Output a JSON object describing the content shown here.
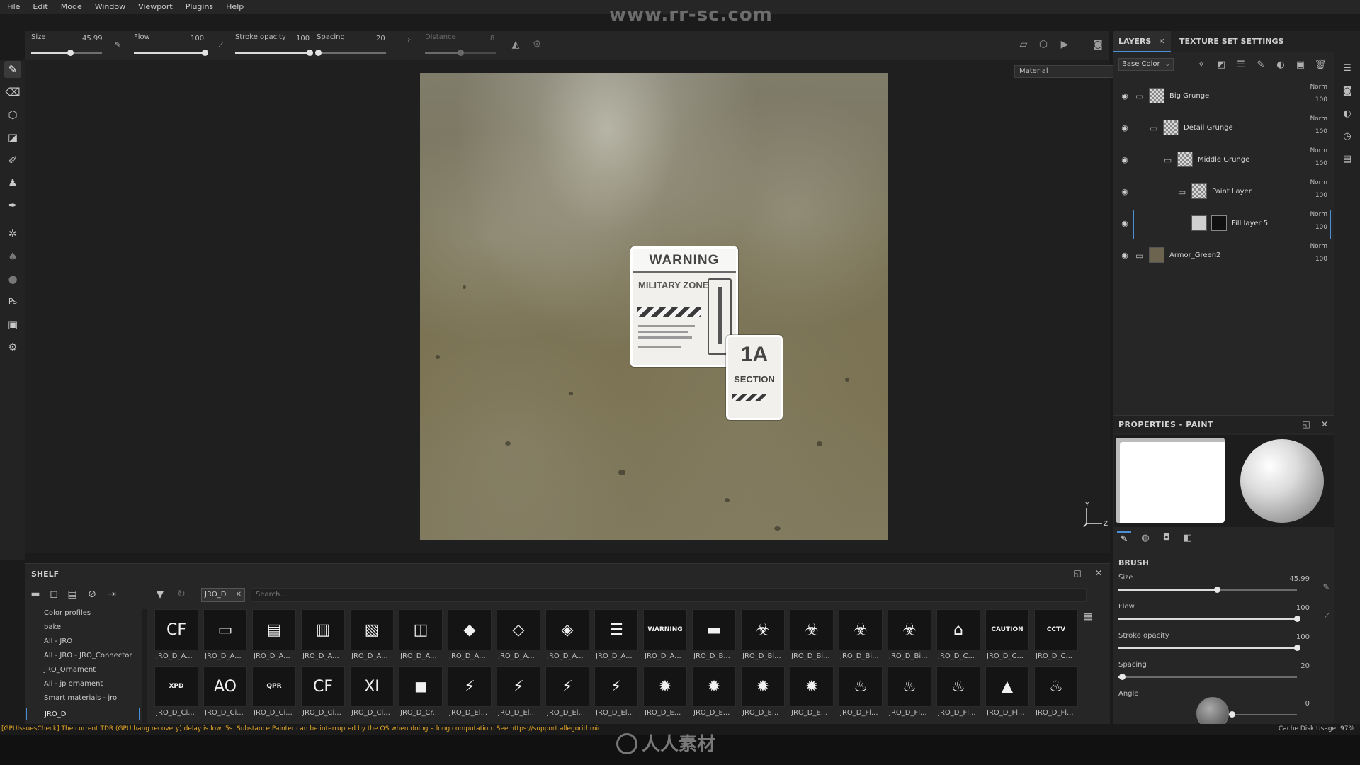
{
  "watermark": "www.rr-sc.com",
  "menu": [
    "File",
    "Edit",
    "Mode",
    "Window",
    "Viewport",
    "Plugins",
    "Help"
  ],
  "tool_options": {
    "size": {
      "label": "Size",
      "value": "45.99",
      "fraction": 0.55
    },
    "flow": {
      "label": "Flow",
      "value": "100",
      "fraction": 1.0
    },
    "stroke_opacity": {
      "label": "Stroke opacity",
      "value": "100",
      "fraction": 1.0
    },
    "spacing": {
      "label": "Spacing",
      "value": "20",
      "fraction": 0.02
    },
    "distance": {
      "label": "Distance",
      "value": "8",
      "fraction": 0.5
    }
  },
  "viewport": {
    "material_select": "Material",
    "decal_warning": {
      "title": "WARNING",
      "subtitle": "MILITARY ZONE"
    },
    "decal_section": {
      "number": "1A",
      "word": "SECTION"
    },
    "gizmo": {
      "y": "Y",
      "z": "Z"
    }
  },
  "right_panel": {
    "tabs": {
      "layers": "LAYERS",
      "texture_set_settings": "TEXTURE SET SETTINGS"
    },
    "channel_select": "Base Color",
    "layers": [
      {
        "name": "Big Grunge",
        "blend": "Norm",
        "opacity": "100",
        "indent": 0,
        "thumb": "checker",
        "folder": true
      },
      {
        "name": "Detail Grunge",
        "blend": "Norm",
        "opacity": "100",
        "indent": 1,
        "thumb": "checker",
        "folder": true
      },
      {
        "name": "Middle Grunge",
        "blend": "Norm",
        "opacity": "100",
        "indent": 2,
        "thumb": "checker",
        "folder": true
      },
      {
        "name": "Paint Layer",
        "blend": "Norm",
        "opacity": "100",
        "indent": 3,
        "thumb": "checker",
        "folder": true
      },
      {
        "name": "Fill layer 5",
        "blend": "Norm",
        "opacity": "100",
        "indent": 4,
        "thumb": "plain",
        "folder": false,
        "selected": true
      },
      {
        "name": "Armor_Green2",
        "blend": "Norm",
        "opacity": "100",
        "indent": 0,
        "thumb": "armor",
        "folder": true
      }
    ],
    "properties": {
      "title": "PROPERTIES - PAINT",
      "brush_title": "BRUSH",
      "sliders": [
        {
          "label": "Size",
          "value": "45.99",
          "fraction": 0.55
        },
        {
          "label": "Flow",
          "value": "100",
          "fraction": 1.0
        },
        {
          "label": "Stroke opacity",
          "value": "100",
          "fraction": 1.0
        },
        {
          "label": "Spacing",
          "value": "20",
          "fraction": 0.02
        },
        {
          "label": "Angle",
          "value": "0",
          "fraction": 0.0
        }
      ]
    }
  },
  "shelf": {
    "title": "SHELF",
    "filter_chip": "JRO_D",
    "search_placeholder": "Search...",
    "categories": [
      "Color profiles",
      "bake",
      "All - JRO",
      "All - JRO - JRO_Connector",
      "JRO_Ornament",
      "All - jp ornament",
      "Smart materials - jro",
      "JRO_D"
    ],
    "selected_category": "JRO_D",
    "row1": [
      {
        "name": "JRO_D_A...",
        "icon": "CF"
      },
      {
        "name": "JRO_D_A...",
        "icon": "▭"
      },
      {
        "name": "JRO_D_A...",
        "icon": "▤"
      },
      {
        "name": "JRO_D_A...",
        "icon": "▥"
      },
      {
        "name": "JRO_D_A...",
        "icon": "▧"
      },
      {
        "name": "JRO_D_A...",
        "icon": "◫"
      },
      {
        "name": "JRO_D_A...",
        "icon": "◆"
      },
      {
        "name": "JRO_D_A...",
        "icon": "◇"
      },
      {
        "name": "JRO_D_A...",
        "icon": "◈"
      },
      {
        "name": "JRO_D_A...",
        "icon": "☰"
      },
      {
        "name": "JRO_D_A...",
        "icon": "WARNING"
      },
      {
        "name": "JRO_D_B...",
        "icon": "▬"
      },
      {
        "name": "JRO_D_Bi...",
        "icon": "☣"
      },
      {
        "name": "JRO_D_Bi...",
        "icon": "☣"
      },
      {
        "name": "JRO_D_Bi...",
        "icon": "☣"
      },
      {
        "name": "JRO_D_Bi...",
        "icon": "☣"
      },
      {
        "name": "JRO_D_C...",
        "icon": "⌂"
      },
      {
        "name": "JRO_D_C...",
        "icon": "CAUTION"
      },
      {
        "name": "JRO_D_C...",
        "icon": "CCTV"
      }
    ],
    "row2": [
      {
        "name": "JRO_D_Ci...",
        "icon": "XPD"
      },
      {
        "name": "JRO_D_Ci...",
        "icon": "AO"
      },
      {
        "name": "JRO_D_Ci...",
        "icon": "QPR"
      },
      {
        "name": "JRO_D_Ci...",
        "icon": "CF"
      },
      {
        "name": "JRO_D_Ci...",
        "icon": "XI"
      },
      {
        "name": "JRO_D_Cr...",
        "icon": "◼"
      },
      {
        "name": "JRO_D_El...",
        "icon": "⚡"
      },
      {
        "name": "JRO_D_El...",
        "icon": "⚡"
      },
      {
        "name": "JRO_D_El...",
        "icon": "⚡"
      },
      {
        "name": "JRO_D_El...",
        "icon": "⚡"
      },
      {
        "name": "JRO_D_E...",
        "icon": "✹"
      },
      {
        "name": "JRO_D_E...",
        "icon": "✹"
      },
      {
        "name": "JRO_D_E...",
        "icon": "✹"
      },
      {
        "name": "JRO_D_E...",
        "icon": "✹"
      },
      {
        "name": "JRO_D_Fl...",
        "icon": "♨"
      },
      {
        "name": "JRO_D_Fl...",
        "icon": "♨"
      },
      {
        "name": "JRO_D_Fl...",
        "icon": "♨"
      },
      {
        "name": "JRO_D_Fl...",
        "icon": "▲"
      },
      {
        "name": "JRO_D_Fl...",
        "icon": "♨"
      }
    ]
  },
  "status": {
    "message": "[GPUIssuesCheck] The current TDR (GPU hang recovery) delay is low: 5s. Substance Painter can be interrupted by the OS when doing a long computation. See https://support.allegorithmic",
    "cache": "Cache Disk Usage:  97%"
  },
  "bottom_logo": "人人素材"
}
